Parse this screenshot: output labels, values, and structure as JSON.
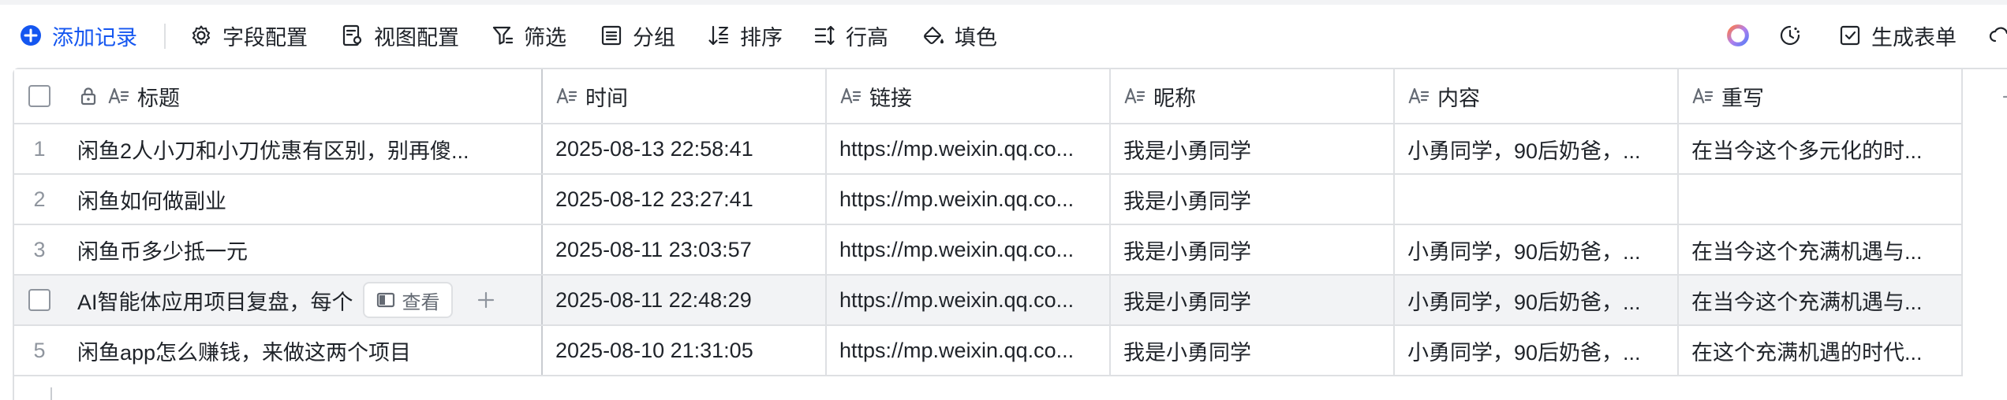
{
  "toolbar": {
    "add_record": "添加记录",
    "field_config": "字段配置",
    "view_config": "视图配置",
    "filter": "筛选",
    "group": "分组",
    "sort": "排序",
    "row_height": "行高",
    "fill_color": "填色",
    "generate_form": "生成表单"
  },
  "columns": [
    {
      "label": "标题",
      "icon": "text-field-icon",
      "locked": true
    },
    {
      "label": "时间",
      "icon": "text-field-icon"
    },
    {
      "label": "链接",
      "icon": "text-field-icon"
    },
    {
      "label": "昵称",
      "icon": "text-field-icon"
    },
    {
      "label": "内容",
      "icon": "text-field-icon"
    },
    {
      "label": "重写",
      "icon": "text-field-icon"
    }
  ],
  "rows": [
    {
      "index": "1",
      "title": "闲鱼2人小刀和小刀优惠有区别，别再傻...",
      "time": "2025-08-13 22:58:41",
      "link": "https://mp.weixin.qq.co...",
      "nickname": "我是小勇同学",
      "content": "小勇同学，90后奶爸，...",
      "rewrite": "在当今这个多元化的时..."
    },
    {
      "index": "2",
      "title": "闲鱼如何做副业",
      "time": "2025-08-12 23:27:41",
      "link": "https://mp.weixin.qq.co...",
      "nickname": "我是小勇同学",
      "content": "",
      "rewrite": ""
    },
    {
      "index": "3",
      "title": "闲鱼币多少抵一元",
      "time": "2025-08-11 23:03:57",
      "link": "https://mp.weixin.qq.co...",
      "nickname": "我是小勇同学",
      "content": "小勇同学，90后奶爸，...",
      "rewrite": "在当今这个充满机遇与..."
    },
    {
      "index": "",
      "title": "AI智能体应用项目复盘，每个",
      "time": "2025-08-11 22:48:29",
      "link": "https://mp.weixin.qq.co...",
      "nickname": "我是小勇同学",
      "content": "小勇同学，90后奶爸，...",
      "rewrite": "在当今这个充满机遇与...",
      "hovered": true
    },
    {
      "index": "5",
      "title": "闲鱼app怎么赚钱，来做这两个项目",
      "time": "2025-08-10 21:31:05",
      "link": "https://mp.weixin.qq.co...",
      "nickname": "我是小勇同学",
      "content": "小勇同学，90后奶爸，...",
      "rewrite": "在这个充满机遇的时代..."
    }
  ],
  "row_actions": {
    "view_label": "查看"
  },
  "colors": {
    "accent": "#1456f0",
    "text": "#1f2329",
    "muted": "#8f959e",
    "border": "#dee0e3",
    "hover_row": "#f2f3f5"
  }
}
